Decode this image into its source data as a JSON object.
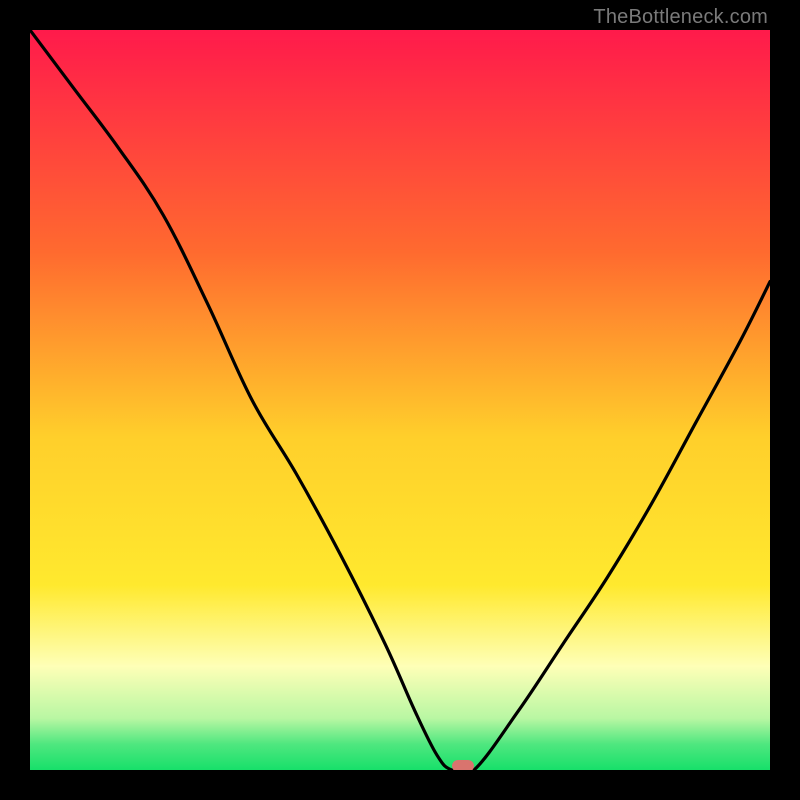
{
  "attribution": "TheBottleneck.com",
  "colors": {
    "red_top": "#ff1a4b",
    "orange": "#ff8a2a",
    "yellow": "#ffe92e",
    "pale_yellow": "#feffb7",
    "green_light": "#8cf29a",
    "green": "#17e06a",
    "black": "#000000",
    "curve": "#000000",
    "marker": "#d9746e",
    "attribution_text": "#7a7a7a"
  },
  "chart_data": {
    "type": "line",
    "title": "",
    "xlabel": "",
    "ylabel": "",
    "xlim": [
      0,
      100
    ],
    "ylim": [
      0,
      100
    ],
    "series": [
      {
        "name": "bottleneck-curve",
        "x": [
          0,
          6,
          12,
          18,
          24,
          30,
          36,
          42,
          48,
          52,
          55,
          57,
          60,
          66,
          72,
          78,
          84,
          90,
          96,
          100
        ],
        "y": [
          100,
          92,
          84,
          75,
          63,
          50,
          40,
          29,
          17,
          8,
          2,
          0,
          0,
          8,
          17,
          26,
          36,
          47,
          58,
          66
        ]
      }
    ],
    "marker": {
      "x": 58.5,
      "y": 0
    },
    "gradient_stops": [
      {
        "pos": 0.0,
        "color": "#ff1a4b"
      },
      {
        "pos": 0.3,
        "color": "#ff6a2f"
      },
      {
        "pos": 0.55,
        "color": "#ffcf2b"
      },
      {
        "pos": 0.75,
        "color": "#ffe92e"
      },
      {
        "pos": 0.86,
        "color": "#feffb7"
      },
      {
        "pos": 0.93,
        "color": "#b9f7a3"
      },
      {
        "pos": 0.965,
        "color": "#4fe77f"
      },
      {
        "pos": 1.0,
        "color": "#17e06a"
      }
    ]
  }
}
